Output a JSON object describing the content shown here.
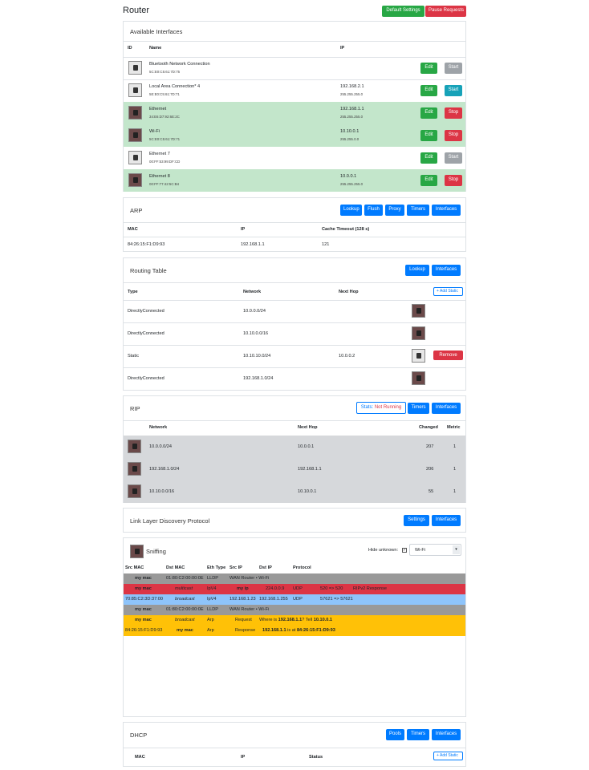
{
  "page": {
    "title": "Router",
    "default_settings": "Default Settings",
    "pause_requests": "Pause Requests"
  },
  "interfaces": {
    "title": "Available Interfaces",
    "col_id": "ID",
    "col_name": "Name",
    "col_ip": "IP",
    "edit": "Edit",
    "start": "Start",
    "stop": "Stop",
    "rows": [
      {
        "name": "Bluetooth Network Connection",
        "mac": "5C:E0:C5:61:7D:75",
        "ip": "",
        "mask": "",
        "action": "Start"
      },
      {
        "name": "Local Area Connection* 4",
        "mac": "5E:E0:C5:61:7D:71",
        "ip": "192.168.2.1",
        "mask": "255.255.255.0",
        "action": "Start"
      },
      {
        "name": "Ethernet",
        "mac": "34:E6:D7:92:6E:2C",
        "ip": "192.168.1.1",
        "mask": "255.255.255.0",
        "action": "Stop"
      },
      {
        "name": "Wi-Fi",
        "mac": "5C:E0:C5:61:7D:71",
        "ip": "10.10.0.1",
        "mask": "255.255.0.0",
        "action": "Stop"
      },
      {
        "name": "Ethernet 7",
        "mac": "00:FF:53:99:DF:CD",
        "ip": "",
        "mask": "",
        "action": "Start"
      },
      {
        "name": "Ethernet 8",
        "mac": "00:FF:77:42:5C:B4",
        "ip": "10.0.0.1",
        "mask": "255.255.255.0",
        "action": "Stop"
      }
    ]
  },
  "arp": {
    "title": "ARP",
    "buttons": [
      "Lookup",
      "Flush",
      "Proxy",
      "Timers",
      "Interfaces"
    ],
    "col_mac": "MAC",
    "col_ip": "IP",
    "col_timeout": "Cache Timeout (128 s)",
    "rows": [
      {
        "mac": "84:26:15:F1:D9:93",
        "ip": "192.168.1.1",
        "timeout": "121"
      }
    ]
  },
  "routing": {
    "title": "Routing Table",
    "buttons": [
      "Lookup",
      "Interfaces"
    ],
    "col_type": "Type",
    "col_network": "Network",
    "col_next_hop": "Next Hop",
    "add_static": "+ Add Static",
    "remove": "Remove",
    "rows": [
      {
        "type": "DirectlyConnected",
        "network": "10.0.0.0/24",
        "next_hop": ""
      },
      {
        "type": "DirectlyConnected",
        "network": "10.10.0.0/16",
        "next_hop": ""
      },
      {
        "type": "Static",
        "network": "10.10.10.0/24",
        "next_hop": "10.0.0.2"
      },
      {
        "type": "DirectlyConnected",
        "network": "192.168.1.0/24",
        "next_hop": ""
      }
    ]
  },
  "rip": {
    "title": "RIP",
    "stats_label": "Stats: ",
    "stats_value": "Not Running",
    "buttons": [
      "Timers",
      "Interfaces"
    ],
    "col_network": "Network",
    "col_next_hop": "Next Hop",
    "col_changed": "Changed",
    "col_metric": "Metric",
    "rows": [
      {
        "network": "10.0.0.0/24",
        "next_hop": "10.0.0.1",
        "changed": "207",
        "metric": "1"
      },
      {
        "network": "192.168.1.0/24",
        "next_hop": "192.168.1.1",
        "changed": "206",
        "metric": "1"
      },
      {
        "network": "10.10.0.0/16",
        "next_hop": "10.10.0.1",
        "changed": "55",
        "metric": "1"
      }
    ]
  },
  "lldp": {
    "title": "Link Layer Discovery Protocol",
    "buttons": [
      "Settings",
      "Interfaces"
    ]
  },
  "sniffing": {
    "title": "Sniffing",
    "hide_unknown": "Hide unknown:",
    "select_value": "Wi-Fi",
    "cols": [
      "Src MAC",
      "Dst MAC",
      "Eth Type",
      "Src IP",
      "Dst IP",
      "Protocol"
    ],
    "rows": [
      {
        "src_mac": "my mac",
        "dst_mac": "01:80:C2:00:00:0E",
        "eth": "LLDP",
        "info": "WAN Router • Wi-Fi",
        "color": "#999999"
      },
      {
        "src_mac": "my mac",
        "dst_mac": "multicast",
        "eth": "IpV4",
        "src_ip": "my ip",
        "dst_ip": "224.0.0.9",
        "proto": "UDP",
        "ports": "520 => 520",
        "extra": "RIPv2 Response",
        "color": "#dc3545"
      },
      {
        "src_mac": "70:85:C2:3D:37:00",
        "dst_mac": "broadcast",
        "eth": "IpV4",
        "src_ip": "192.168.1.23",
        "dst_ip": "192.168.1.255",
        "proto": "UDP",
        "ports": "57621 => 57621",
        "color": "#8ec4fb"
      },
      {
        "src_mac": "my mac",
        "dst_mac": "01:80:C2:00:00:0E",
        "eth": "LLDP",
        "info": "WAN Router • Wi-Fi",
        "color": "#999999"
      },
      {
        "src_mac": "my mac",
        "dst_mac": "broadcast",
        "eth": "Arp",
        "op": "Request",
        "msg_a": "Where is ",
        "msg_b": "192.168.1.1",
        "msg_c": "? Tell ",
        "msg_d": "10.10.0.1",
        "color": "#ffc107"
      },
      {
        "src_mac": "84:26:15:F1:D9:93",
        "dst_mac": "my mac",
        "eth": "Arp",
        "op": "Response",
        "msg_a": "192.168.1.1",
        "msg_b": " is at ",
        "msg_c": "84:26:15:F1:D9:93",
        "color": "#ffc107"
      }
    ]
  },
  "dhcp": {
    "title": "DHCP",
    "buttons": [
      "Pools",
      "Timers",
      "Interfaces"
    ],
    "col_mac": "MAC",
    "col_ip": "IP",
    "col_status": "Status",
    "add_static": "+ Add Static"
  }
}
